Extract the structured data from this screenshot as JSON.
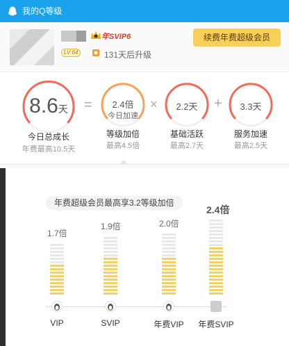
{
  "window": {
    "title": "我的Q等级",
    "title_icon": "qq-penguin-icon",
    "title_color": "#1aa3ec"
  },
  "header": {
    "svip_badge": "年SVIP6",
    "level_badge": "LV 64",
    "upgrade_text": "131天后升级",
    "renew_button": "续费年费超级会员"
  },
  "gauges": {
    "total": {
      "value": "8.6",
      "unit": "天",
      "label": "今日总成长",
      "sub": "年费最高10.5天"
    },
    "level": {
      "value": "2.4倍",
      "inner_sub": "今日加速",
      "label": "等级加倍",
      "sub": "最高4.5倍"
    },
    "active": {
      "value": "2.2天",
      "label": "基础活跃",
      "sub": "最高2.7天"
    },
    "service": {
      "value": "3.3天",
      "label": "服务加速",
      "sub": "最高2.5天"
    },
    "op_eq": "=",
    "op_mul": "×",
    "op_plus": "+"
  },
  "chart_data": {
    "type": "bar",
    "title": "年费超级会员最高享3.2等级加倍",
    "categories": [
      "VIP",
      "SVIP",
      "年费VIP",
      "年费SVIP"
    ],
    "labels": [
      "1.7倍",
      "1.9倍",
      "2.0倍",
      "2.4倍"
    ],
    "values": [
      1.7,
      1.9,
      2.0,
      2.4
    ],
    "ylim": [
      0,
      2.4
    ],
    "colors": {
      "fill": "#f5d163",
      "rest": "#e8e8e8"
    }
  }
}
